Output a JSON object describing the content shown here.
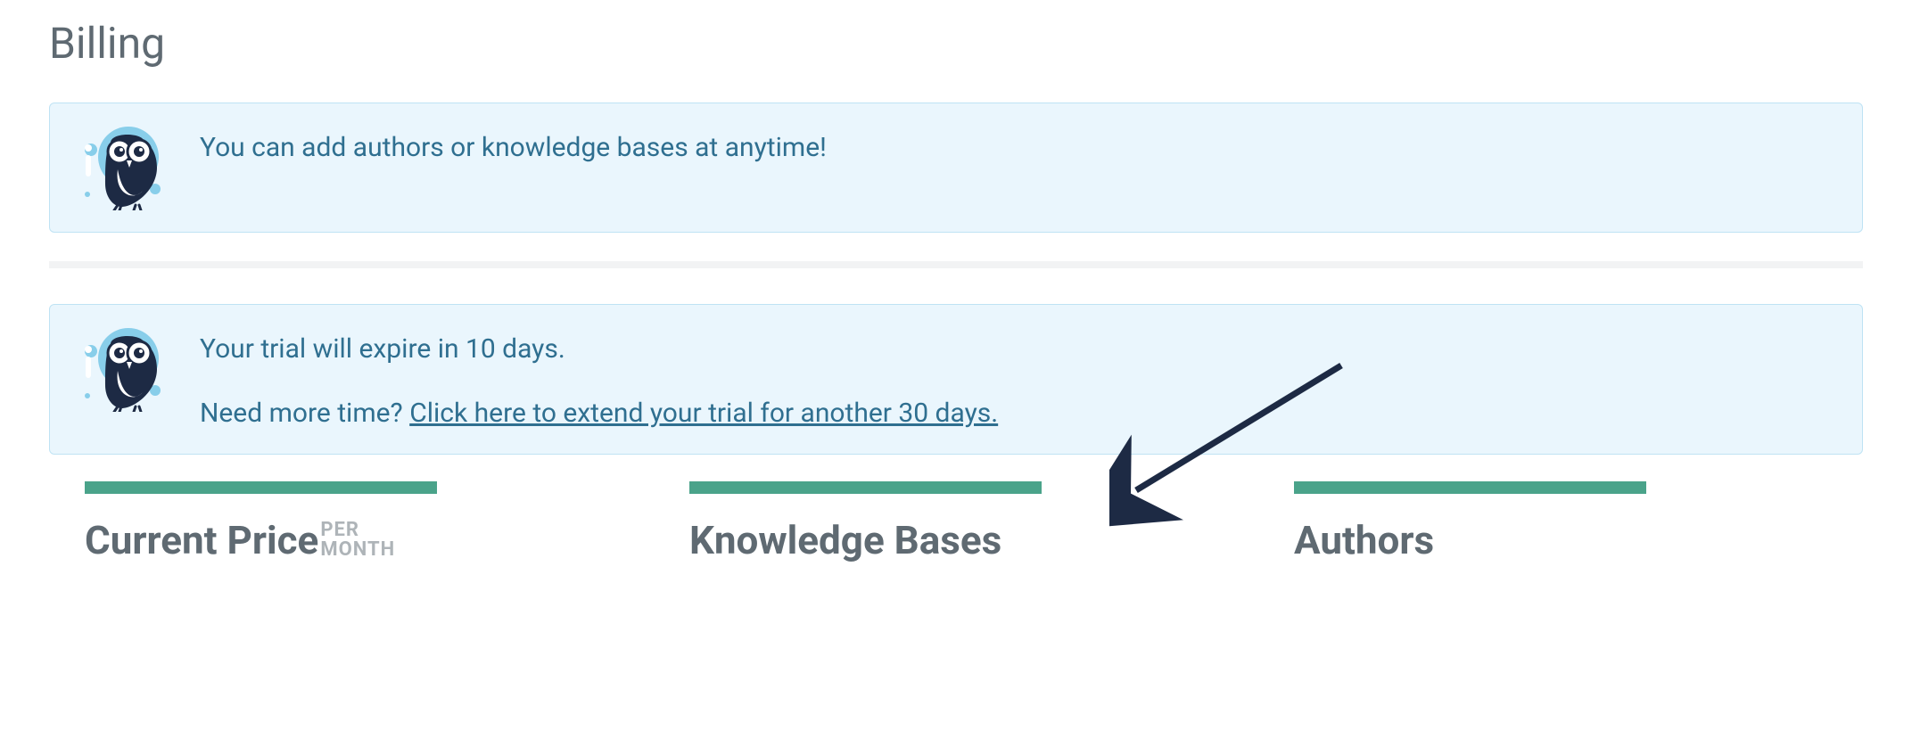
{
  "page": {
    "title": "Billing"
  },
  "banner1": {
    "message": "You can add authors or knowledge bases at anytime!"
  },
  "banner2": {
    "line1": "Your trial will expire in 10 days.",
    "line2_prefix": "Need more time? ",
    "line2_link": "Click here to extend your trial for another 30 days."
  },
  "stats": {
    "price": {
      "label": "Current Price",
      "sub1": "PER",
      "sub2": "MONTH"
    },
    "kb": {
      "label": "Knowledge Bases"
    },
    "authors": {
      "label": "Authors"
    }
  },
  "colors": {
    "banner_bg": "#eaf6fd",
    "banner_border": "#bfe3f4",
    "banner_text": "#2f6f90",
    "heading": "#5f6a72",
    "stat_bar": "#4aa38a",
    "muted": "#aeb4b8",
    "arrow": "#1d2a44"
  }
}
